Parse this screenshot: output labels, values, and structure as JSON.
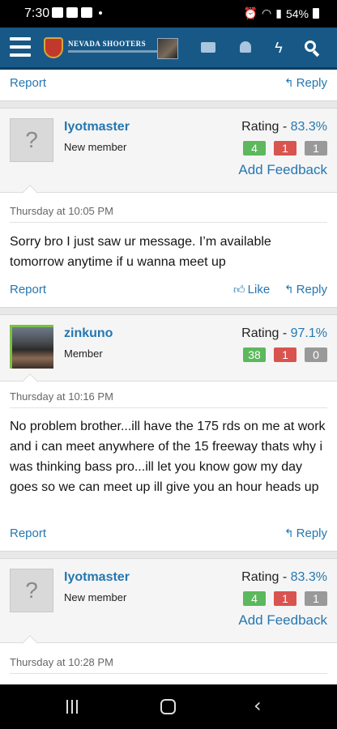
{
  "status_bar": {
    "time": "7:30",
    "battery": "54%"
  },
  "header": {
    "logo_title": "NEVADA SHOOTERS"
  },
  "posts": [
    {
      "report_label": "Report",
      "reply_label": "Reply"
    },
    {
      "user": "Iyotmaster",
      "user_title": "New member",
      "rating_label": "Rating - ",
      "rating_pct": "83.3%",
      "positive": "4",
      "negative": "1",
      "neutral": "1",
      "feedback_label": "Add Feedback",
      "date": "Thursday at 10:05 PM",
      "message": "Sorry bro I just saw ur message. I’m available tomorrow anytime if u wanna meet up",
      "report_label": "Report",
      "like_label": "Like",
      "reply_label": "Reply"
    },
    {
      "user": "zinkuno",
      "user_title": "Member",
      "rating_label": "Rating - ",
      "rating_pct": "97.1%",
      "positive": "38",
      "negative": "1",
      "neutral": "0",
      "date": "Thursday at 10:16 PM",
      "message": "No problem brother...ill have the 175 rds on me at work and i can meet anywhere of the 15 freeway thats why i was thinking bass pro...ill let you know gow my day goes so we can meet up ill give you an hour heads up",
      "report_label": "Report",
      "reply_label": "Reply"
    },
    {
      "user": "Iyotmaster",
      "user_title": "New member",
      "rating_label": "Rating - ",
      "rating_pct": "83.3%",
      "positive": "4",
      "negative": "1",
      "neutral": "1",
      "feedback_label": "Add Feedback",
      "date": "Thursday at 10:28 PM"
    }
  ]
}
